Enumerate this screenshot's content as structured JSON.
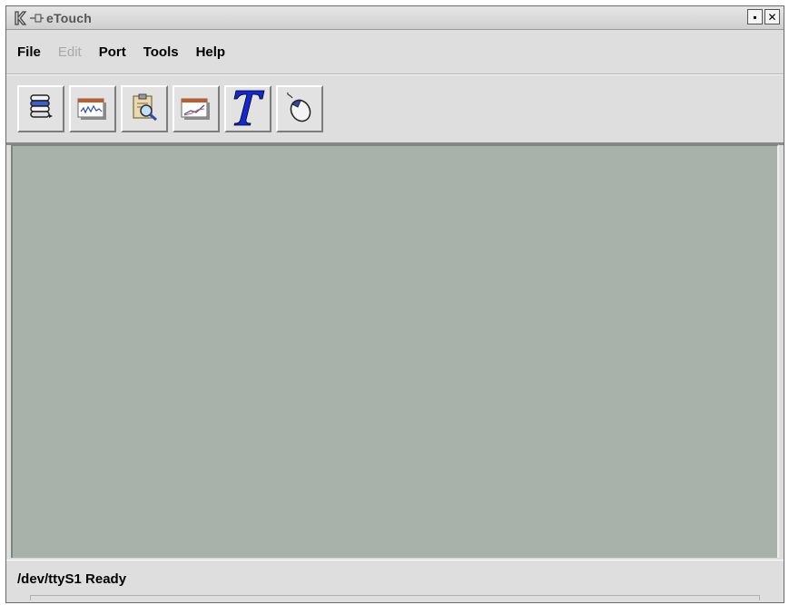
{
  "window": {
    "title": "eTouch",
    "buttons": [
      {
        "name": "restore",
        "glyph": "▪"
      },
      {
        "name": "close",
        "glyph": "✕"
      }
    ]
  },
  "menubar": {
    "items": [
      {
        "label": "File",
        "enabled": true
      },
      {
        "label": "Edit",
        "enabled": false
      },
      {
        "label": "Port",
        "enabled": true
      },
      {
        "label": "Tools",
        "enabled": true
      },
      {
        "label": "Help",
        "enabled": true
      }
    ]
  },
  "toolbar": {
    "buttons": [
      {
        "icon": "serial-port-icon"
      },
      {
        "icon": "waveform-window-icon"
      },
      {
        "icon": "clipboard-inspect-icon"
      },
      {
        "icon": "graph-window-icon"
      },
      {
        "icon": "text-t-icon"
      },
      {
        "icon": "mouse-icon"
      }
    ]
  },
  "statusbar": {
    "text": "/dev/ttyS1 Ready"
  },
  "colors": {
    "workspace": "#a8b1aa",
    "window_bg": "#dedede"
  }
}
